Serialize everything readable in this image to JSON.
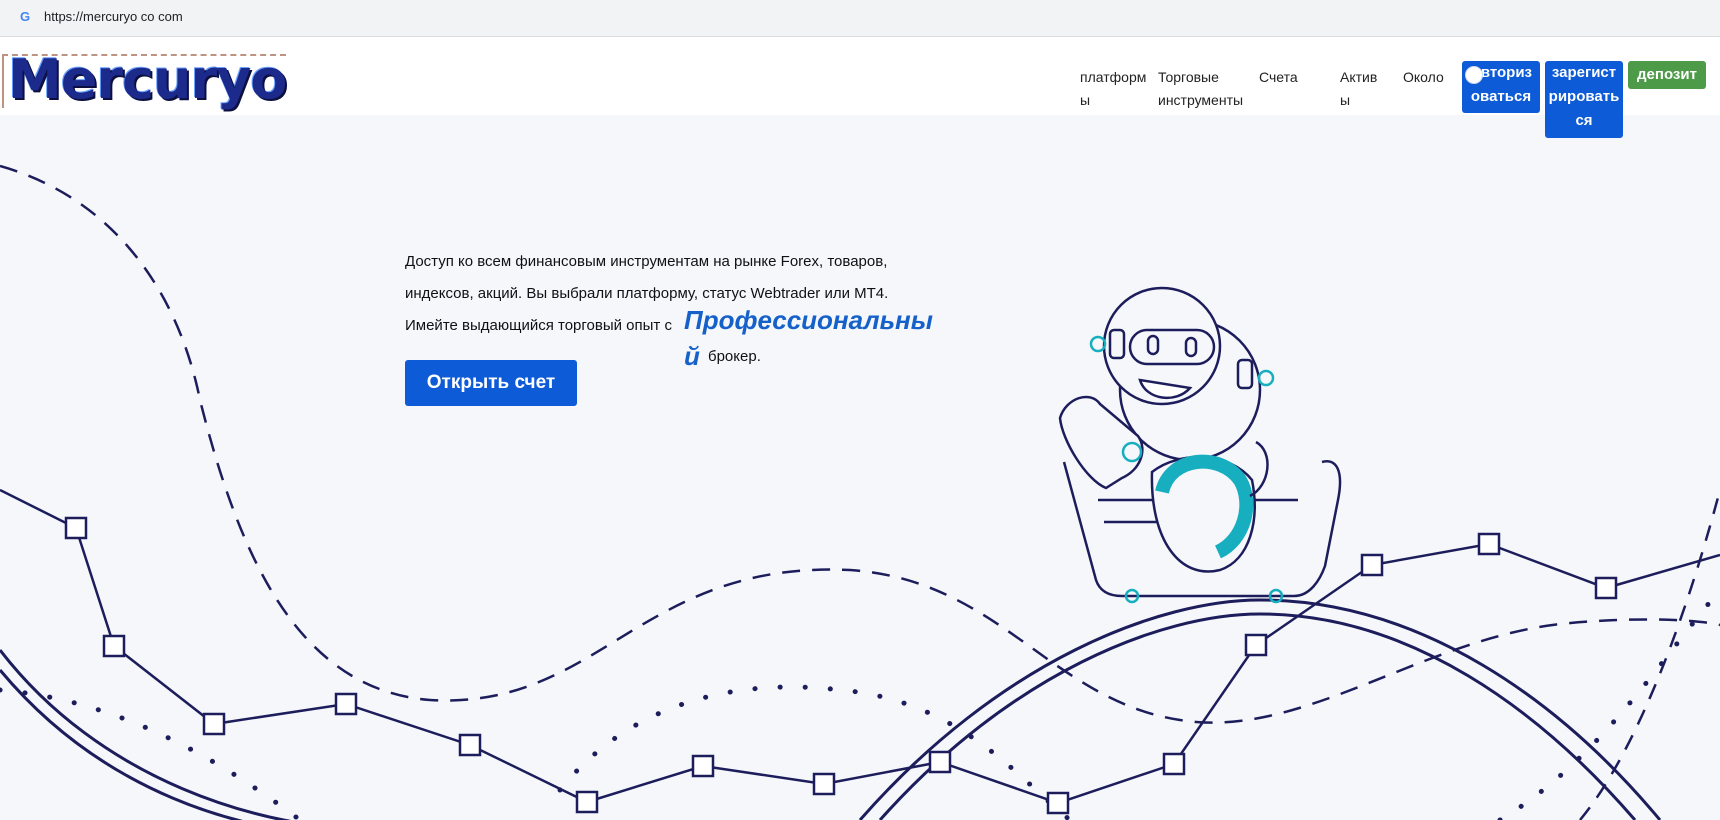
{
  "browser": {
    "url": "https://mercuryo co com",
    "site_icon": "google-g-icon"
  },
  "header": {
    "logo_text": "Mercuryo",
    "nav": [
      {
        "label_line1": "платформ",
        "label_line2": "ы"
      },
      {
        "label_line1": "Торговые",
        "label_line2": "инструменты"
      },
      {
        "label_line1": "Счета",
        "label_line2": ""
      },
      {
        "label_line1": "Актив",
        "label_line2": "ы"
      },
      {
        "label_line1": "Около",
        "label_line2": ""
      }
    ],
    "login_button": {
      "line1": "Авториз",
      "line2": "оваться"
    },
    "register_button": {
      "line1": "зарегист",
      "line2": "рировать",
      "line3": "ся"
    },
    "deposit_button": "депозит"
  },
  "hero": {
    "paragraph_line1": "Доступ ко всем финансовым инструментам на рынке Forex, товаров,",
    "paragraph_line2": "индексов, акций. Вы выбрали платформу, статус Webtrader или MT4.",
    "paragraph_line3": "Имейте выдающийся торговый опыт с",
    "highlight_line1": "Профессиональны",
    "highlight_line2": "й",
    "after_highlight": "брокер.",
    "cta": "Открыть счет"
  },
  "colors": {
    "primary_blue": "#0d5bd6",
    "deposit_green": "#4d9a48",
    "line_navy": "#1d1d5c",
    "accent_teal": "#17aebf",
    "background": "#f5f7fb"
  }
}
